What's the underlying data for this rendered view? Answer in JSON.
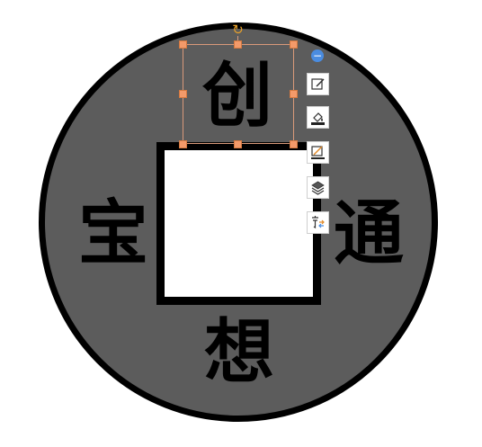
{
  "coin": {
    "top_char": "创",
    "left_char": "宝",
    "right_char": "通",
    "bottom_char": "想"
  },
  "colors": {
    "coin_fill": "#5c5c5c",
    "coin_border": "#000000",
    "hole_fill": "#ffffff",
    "selection_border": "#d99a7a",
    "handle": "#f39a6a",
    "rotate": "#e7a02a",
    "collapse_button": "#4a8ce0"
  },
  "floating_toolbar": {
    "collapse": "−",
    "buttons": [
      {
        "name": "edit-shape-icon"
      },
      {
        "name": "fill-color-icon"
      },
      {
        "name": "line-color-icon"
      },
      {
        "name": "layers-icon"
      },
      {
        "name": "text-wrap-icon"
      }
    ]
  }
}
